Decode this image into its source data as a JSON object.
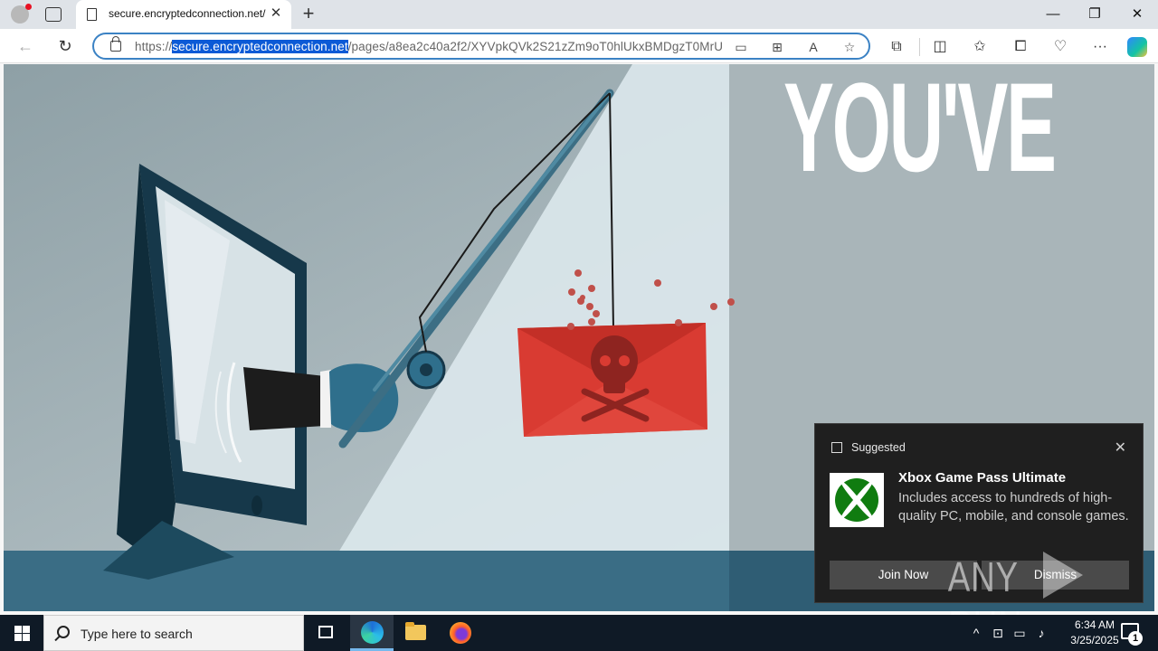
{
  "window": {
    "tab_title": "secure.encryptedconnection.net/",
    "minimize": "—",
    "restore": "❐",
    "close": "✕"
  },
  "address_bar": {
    "scheme": "https://",
    "host": "secure.encryptedconnection.net",
    "path": "/pages/a8ea2c40a2f2/XYVpkQVk2S21zZm9oT0hlUkxBMDgzT0MrU"
  },
  "page": {
    "headline": "YOU'VE"
  },
  "toast": {
    "header": "Suggested",
    "title": "Xbox Game Pass Ultimate",
    "body": "Includes access to hundreds of high-quality PC, mobile, and console games.",
    "primary_button": "Join Now",
    "secondary_button": "Dismiss"
  },
  "watermark": {
    "left": "ANY",
    "right": "RUN"
  },
  "taskbar": {
    "search_placeholder": "Type here to search",
    "time": "6:34 AM",
    "date": "3/25/2025",
    "notification_count": "1"
  },
  "colors": {
    "accent": "#0c5ad6",
    "page_bg": "#aab6ba",
    "envelope": "#d93b32",
    "xbox_green": "#107c10",
    "taskbar": "#0f1a26"
  }
}
